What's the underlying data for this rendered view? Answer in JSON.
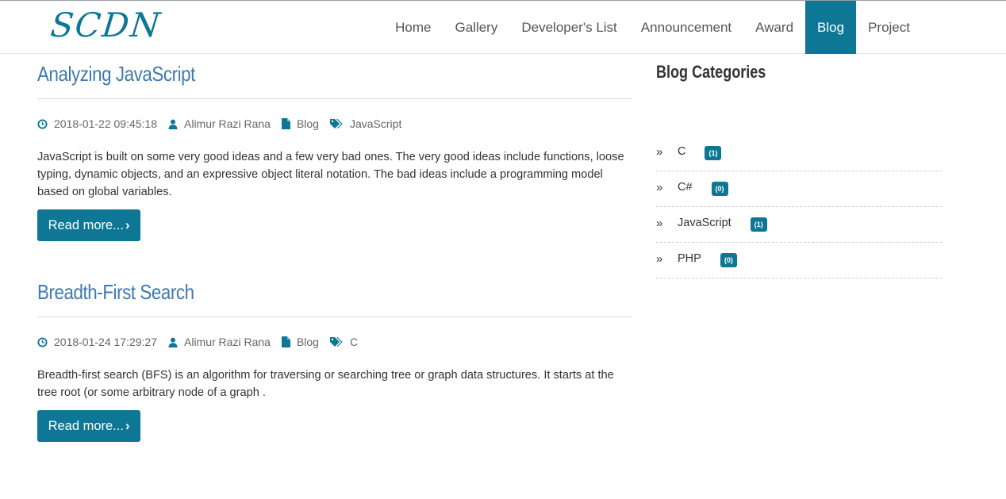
{
  "brand": {
    "logo": "SCDN"
  },
  "nav": {
    "items": [
      {
        "label": "Home"
      },
      {
        "label": "Gallery"
      },
      {
        "label": "Developer's List"
      },
      {
        "label": "Announcement"
      },
      {
        "label": "Award"
      },
      {
        "label": "Blog",
        "active": true
      },
      {
        "label": "Project"
      }
    ]
  },
  "posts": [
    {
      "title": "Analyzing JavaScript",
      "datetime": "2018-01-22 09:45:18",
      "author": "Alimur Razi Rana",
      "section": "Blog",
      "tag": "JavaScript",
      "excerpt": "JavaScript is built on some very good ideas and a few very bad ones. The very good ideas include functions, loose typing, dynamic objects, and an expressive object literal notation. The bad ideas include a programming model based on global variables.",
      "button": "Read more..."
    },
    {
      "title": "Breadth-First Search",
      "datetime": "2018-01-24 17:29:27",
      "author": "Alimur Razi Rana",
      "section": "Blog",
      "tag": "C",
      "excerpt": "Breadth-first search (BFS) is an algorithm for traversing or searching tree or graph data structures. It starts at the tree root (or some arbitrary node of a graph .",
      "button": "Read more..."
    }
  ],
  "sidebar": {
    "title": "Blog Categories",
    "categories": [
      {
        "name": "C",
        "count": "(1)"
      },
      {
        "name": "C#",
        "count": "(0)"
      },
      {
        "name": "JavaScript",
        "count": "(1)"
      },
      {
        "name": "PHP",
        "count": "(0)"
      }
    ]
  },
  "colors": {
    "accent": "#0e7796",
    "title_link": "#3f7ab0"
  }
}
